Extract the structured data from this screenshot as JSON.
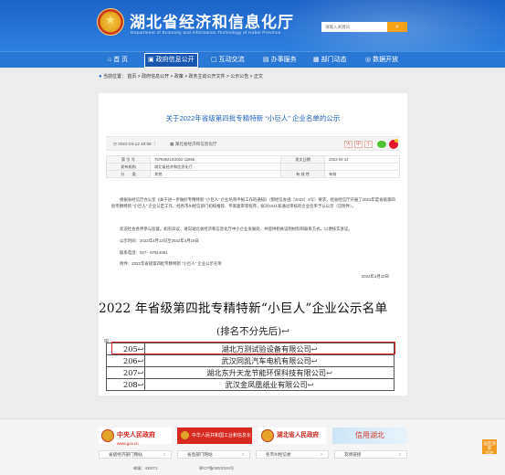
{
  "header": {
    "title": "湖北省经济和信息化厅",
    "subtitle": "Department of Economy and Information Technology of Hubei Province",
    "search_placeholder": "请输入关键词",
    "search_icon": "search-icon"
  },
  "nav": {
    "items": [
      {
        "label": "首 页",
        "icon": "home-icon"
      },
      {
        "label": "政府信息公开",
        "icon": "info-icon"
      },
      {
        "label": "互动交流",
        "icon": "chat-icon"
      },
      {
        "label": "办事服务",
        "icon": "service-icon"
      },
      {
        "label": "部门动态",
        "icon": "news-icon"
      },
      {
        "label": "数据开放",
        "icon": "data-icon"
      }
    ]
  },
  "breadcrumb": "当前位置： 首页 > 政府信息公开 > 政策 > 政务主动公开文件 > 公示公告 > 正文",
  "article": {
    "title": "关于2022年省级第四批专精特新 “小巨人” 企业名单的公示",
    "date": "2022-04-12 10:58",
    "source": "湖北省经济和信息化厅",
    "font_sizes": [
      "大",
      "中",
      "小"
    ],
    "info_table": [
      [
        "索 引 号",
        "757939216/2022-11685",
        "发文日期",
        "2022-04-12"
      ],
      [
        "发布机构",
        "湖北省经济和信息化厅",
        "",
        ""
      ],
      [
        "分　　类",
        "其他",
        "有 效 性",
        "有效"
      ]
    ],
    "paragraphs": [
      "根据省经信厅办公室《关于进一步做好专精特新 “小巨人” 企业培育申报工作的通知》（鄂经信办函〔2022〕3号）要求，经省经信厅开展了2022年度省级第四批专精特新 “小巨人” 企业认定工作，经各市州经信部门初核推荐、专家复审等程序，拟对1041家通过审核的企业名单予以公示（见附件）。",
      "欢迎社会各界参与监督。如有异议，请向湖北省经济和信息化厅中小企业发展处、并提供相关证明材料和联系方式，以便核实查证。",
      "公示时间：2022年4月12日至2022年4月19日",
      "联系电话：027 - 87814061",
      "附件：2022年省级第四批专精特新 “小巨人” 企业公示名单"
    ],
    "sign_date": "2022年4月12日"
  },
  "doc_image": {
    "big_title": "2022 年省级第四批专精特新“小巨人”企业公示名单",
    "note": "(排名不分先后)↩",
    "rows": [
      {
        "num": "205↩",
        "name": "湖北万测试验设备有限公司↩"
      },
      {
        "num": "206↩",
        "name": "武汉同凯汽车电机有限公司↩"
      },
      {
        "num": "207↩",
        "name": "湖北东升天龙节能环保科技有限公司↩"
      },
      {
        "num": "208↩",
        "name": "武汉金凤凰纸业有限公司↩"
      }
    ]
  },
  "footer": {
    "logos": [
      "中央人民政府",
      "中华人民共和国工业和信息化部",
      "湖北省人民政府",
      "信用湖北"
    ],
    "logo1_sub": "www.gov.cn",
    "selects": [
      "省级经济部门网站",
      "省直部门网站",
      "各市州经信委",
      "友情链接"
    ],
    "postcode": "邮编：430071",
    "beian": "鄂ICP备05002344号"
  },
  "totop_label": "返回顶部",
  "totop_short": "TOP"
}
